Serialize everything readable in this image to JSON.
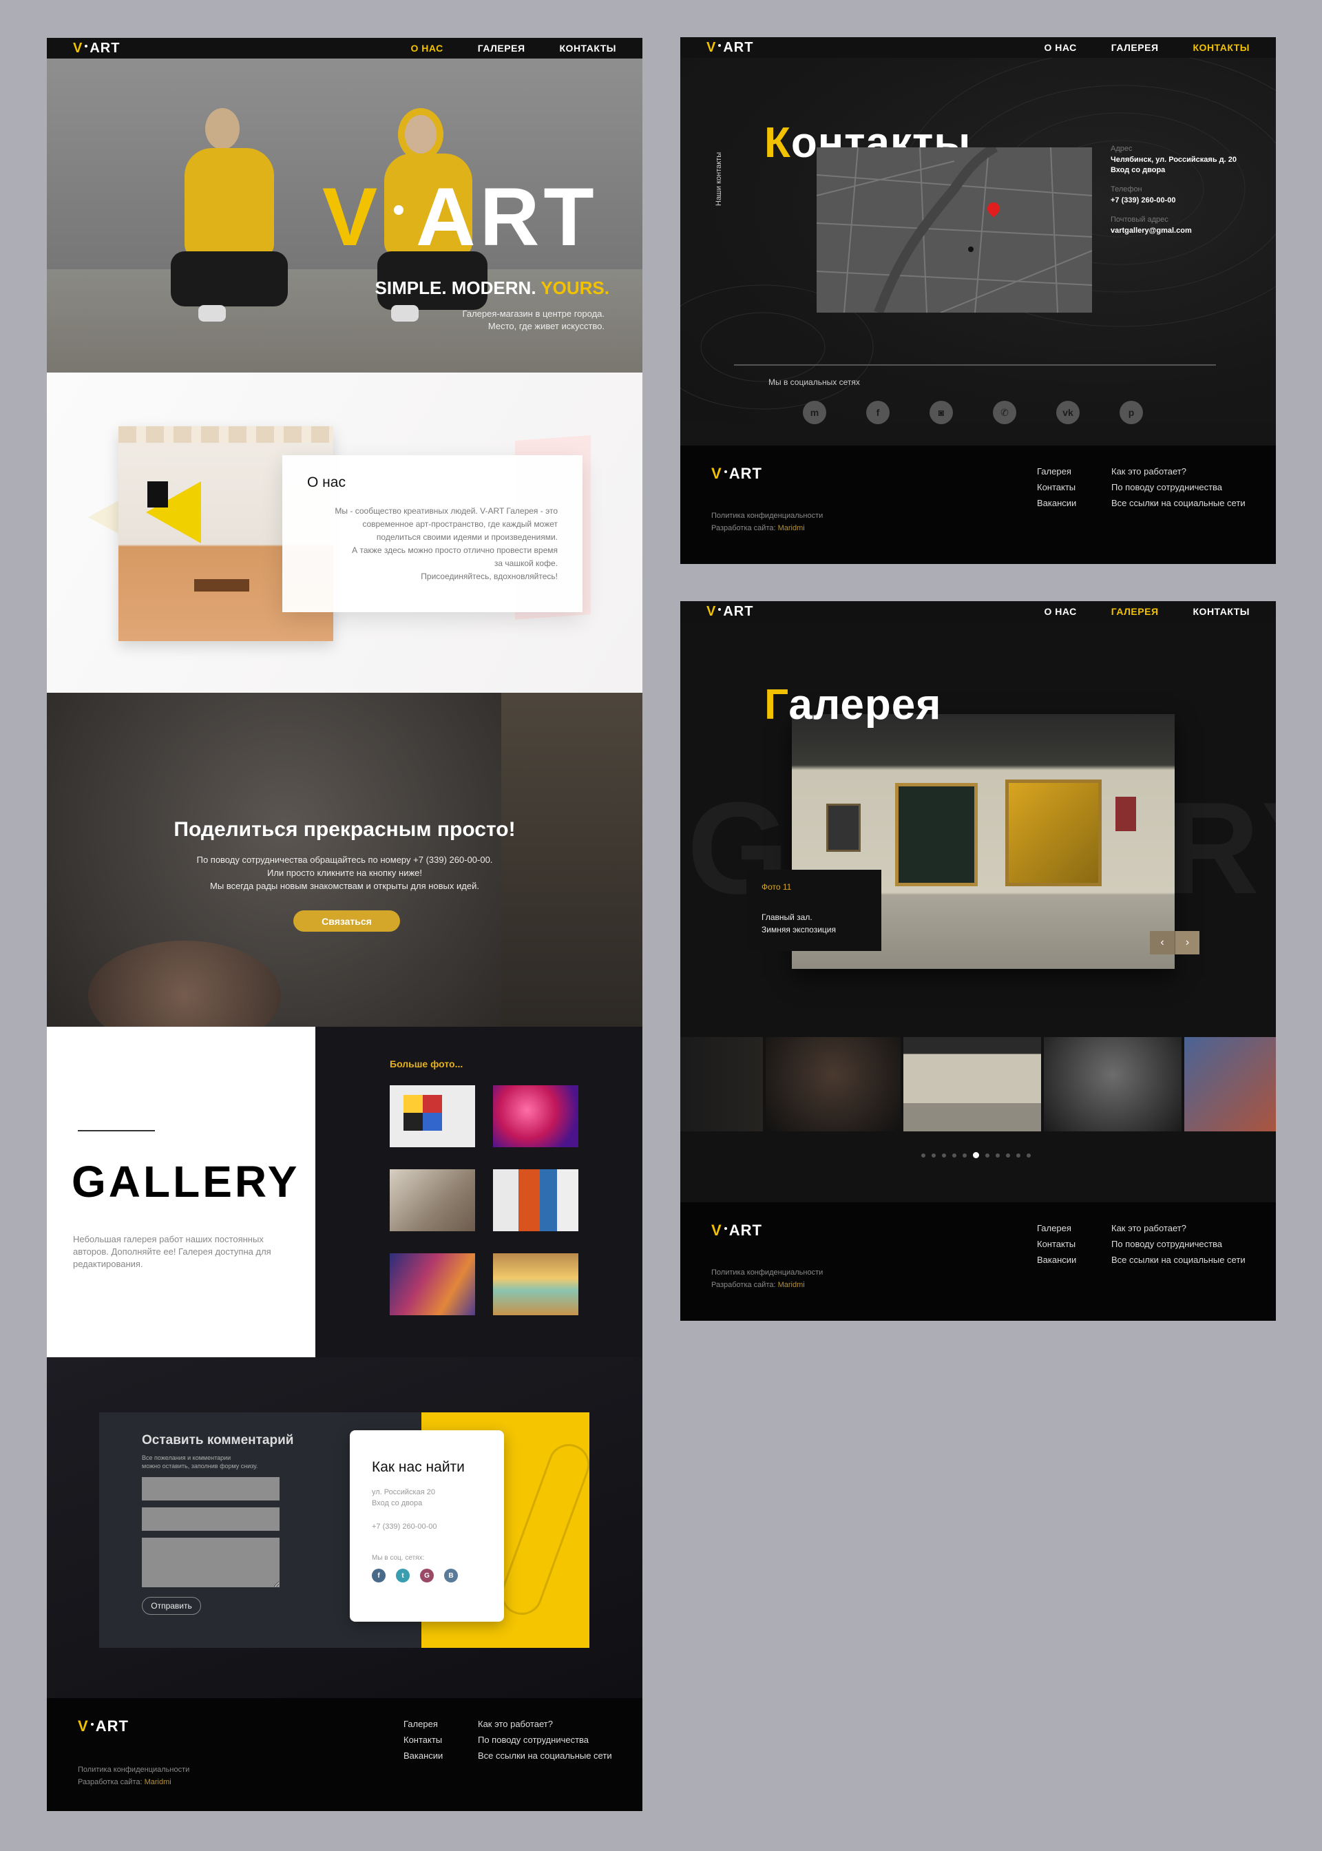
{
  "brand": {
    "logo_left": "V",
    "logo_right": "ART",
    "accent": "#f2c200"
  },
  "home": {
    "nav": {
      "about": "О НАС",
      "gallery": "ГАЛЕРЕЯ",
      "contacts": "КОНТАКТЫ"
    },
    "hero": {
      "logo_left": "V",
      "logo_right": "ART",
      "tagline_white": "SIMPLE. MODERN.",
      "tagline_yellow": "YOURS.",
      "sub_line1": "Галерея-магазин в центре города.",
      "sub_line2": "Место, где живет искусство."
    },
    "about": {
      "title": "О нас",
      "line1": "Мы - сообщество креативных людей. V-ART Галерея - это",
      "line2": "современное арт-пространство, где каждый может",
      "line3": "поделиться своими идеями и произведениями.",
      "line4": "А также здесь можно просто отлично провести время",
      "line5": "за чашкой кофе.",
      "line6": "Присоединяйтесь, вдохновляйтесь!"
    },
    "share": {
      "title": "Поделиться прекрасным просто!",
      "line1": "По поводу сотрудничества обращайтесь по номеру +7 (339) 260-00-00.",
      "line2": "Или просто кликните на кнопку ниже!",
      "line3": "Мы всегда рады новым знакомствам и открыты для новых идей.",
      "button": "Связаться"
    },
    "gallery": {
      "word": "GALLERY",
      "desc": "Небольшая галерея работ наших постоянных авторов. Дополняйте ее! Галерея доступна для редактирования.",
      "more": "Больше фото..."
    },
    "comment_form": {
      "title": "Оставить комментарий",
      "hint_line1": "Все пожелания и комментарии",
      "hint_line2": "можно оставить, заполнив форму снизу.",
      "submit": "Отправить"
    },
    "find_us": {
      "title": "Как нас найти",
      "addr_line1": "ул. Российская 20",
      "addr_line2": "Вход со двора",
      "phone": "+7 (339) 260-00-00",
      "social_label": "Мы в соц. сетях:",
      "icons": [
        "facebook-icon",
        "twitter-icon",
        "google-plus-icon",
        "vk-icon"
      ]
    }
  },
  "footer": {
    "privacy": "Политика конфиденциальности",
    "dev_label": "Разработка сайта:",
    "dev_name": "Maridmi",
    "col1": [
      "Галерея",
      "Контакты",
      "Вакансии"
    ],
    "col2": [
      "Как это работает?",
      "По поводу сотрудничества",
      "Все ссылки на социальные сети"
    ]
  },
  "contacts_page": {
    "nav": {
      "about": "О НАС",
      "gallery": "ГАЛЕРЕЯ",
      "contacts": "КОНТАКТЫ"
    },
    "vertical_label": "Наши контакты",
    "title_first": "К",
    "title_rest": "онтакты",
    "address_label": "Адрес",
    "address_line1": "Челябинск, ул. Российскаяь д. 20",
    "address_line2": "Вход со двора",
    "phone_label": "Телефон",
    "phone": "+7 (339) 260-00-00",
    "email_label": "Почтовый адрес",
    "email": "vartgallery@gmal.com",
    "social_title": "Мы в социальных сетях",
    "social_icons": [
      "messenger-icon",
      "facebook-icon",
      "instagram-icon",
      "whatsapp-icon",
      "vk-icon",
      "pinterest-icon"
    ]
  },
  "gallery_page": {
    "nav": {
      "about": "О НАС",
      "gallery": "ГАЛЕРЕЯ",
      "contacts": "КОНТАКТЫ"
    },
    "title_first": "Г",
    "title_rest": "алерея",
    "ghost_text": "GALLERY",
    "caption_number": "Фото 11",
    "caption_line1": "Главный зал.",
    "caption_line2": "Зимняя экспозиция",
    "slides_total": 11,
    "slide_active": 6
  }
}
